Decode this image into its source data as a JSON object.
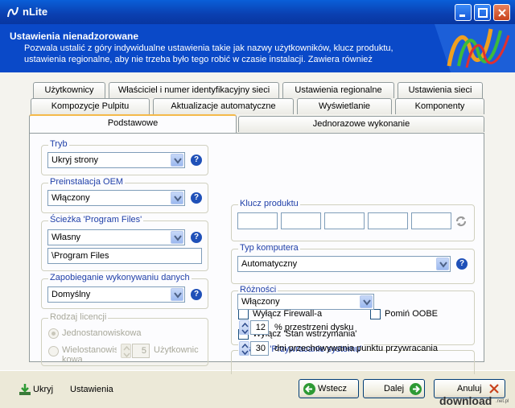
{
  "window": {
    "title": "nLite"
  },
  "header": {
    "title": "Ustawienia nienadzorowane",
    "description": "Pozwala ustalić z góry indywidualne ustawienia takie jak nazwy użytkowników, klucz produktu, ustawienia regionalne, aby nie trzeba było tego robić w czasie instalacji. Zawiera również"
  },
  "tabs": {
    "row1": [
      "Użytkownicy",
      "Właściciel i numer identyfikacyjny sieci",
      "Ustawienia regionalne",
      "Ustawienia sieci"
    ],
    "row2": [
      "Kompozycje Pulpitu",
      "Aktualizacje automatyczne",
      "Wyświetlanie",
      "Komponenty"
    ],
    "row3": [
      "Podstawowe",
      "Jednorazowe wykonanie"
    ]
  },
  "left": {
    "tryb": {
      "label": "Tryb",
      "value": "Ukryj strony"
    },
    "oem": {
      "label": "Preinstalacja OEM",
      "value": "Włączony"
    },
    "program_files": {
      "label": "Ścieżka 'Program Files'",
      "value": "Własny",
      "path": "\\Program Files"
    },
    "dep": {
      "label": "Zapobieganie wykonywaniu danych",
      "value": "Domyślny"
    },
    "license": {
      "label": "Rodzaj licencji",
      "option1": "Jednostanowiskowa",
      "option2": "Wielostanowis kowa",
      "count": "5",
      "users_label": "Użytkownic"
    }
  },
  "right": {
    "product_key": {
      "label": "Klucz produktu"
    },
    "computer_type": {
      "label": "Typ komputera",
      "value": "Automatyczny"
    },
    "misc": {
      "label": "Różności",
      "firewall": "Wyłącz Firewall-a",
      "oobe": "Pomiń OOBE",
      "hibernate": "Wyłącz 'Stan wstrzymania'"
    },
    "restore": {
      "label": "Usługa 'Przywracanie systemu'",
      "value": "Włączony",
      "disk_value": "12",
      "disk_label": "% przestrzeni dysku",
      "days_value": "30",
      "days_label": "dni przechowywania punktu przywracania"
    }
  },
  "footer": {
    "hide": "Ukryj",
    "settings": "Ustawienia",
    "back": "Wstecz",
    "next": "Dalej",
    "cancel": "Anuluj",
    "brand_main": "download",
    "brand_suffix": ".net.pl"
  },
  "icons": {
    "help": "?"
  },
  "colors": {
    "accent": "#0a49c8",
    "group_label": "#1f3fa8",
    "active_tab": "#f4b94a",
    "ok_green": "#2e9a34",
    "cancel_red": "#c8421c"
  }
}
